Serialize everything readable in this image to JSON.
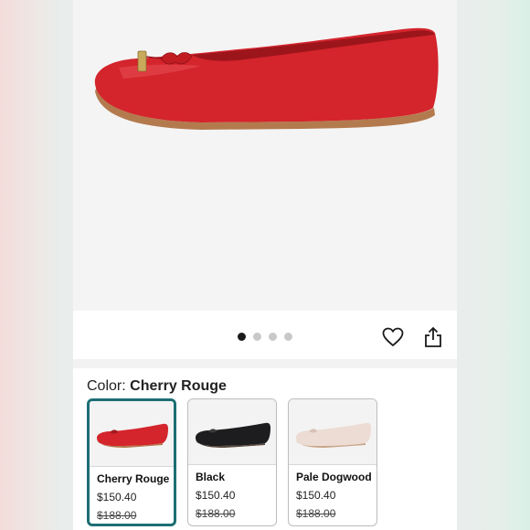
{
  "carousel": {
    "slide_count": 4,
    "active_index": 0
  },
  "actions": {
    "favorite_icon": "heart-icon",
    "share_icon": "share-icon"
  },
  "color_selector": {
    "label": "Color:",
    "selected_value": "Cherry Rouge",
    "options": [
      {
        "name": "Cherry Rouge",
        "price": "$150.40",
        "original_price": "$188.00",
        "color": "#d4242c",
        "selected": true
      },
      {
        "name": "Black",
        "price": "$150.40",
        "original_price": "$188.00",
        "color": "#1d1d1f",
        "selected": false
      },
      {
        "name": "Pale Dogwood",
        "price": "$150.40",
        "original_price": "$188.00",
        "color": "#ecdcd4",
        "selected": false
      }
    ]
  },
  "colors": {
    "selected_border": "#1c6e74",
    "shoe_red": "#d4242c"
  }
}
